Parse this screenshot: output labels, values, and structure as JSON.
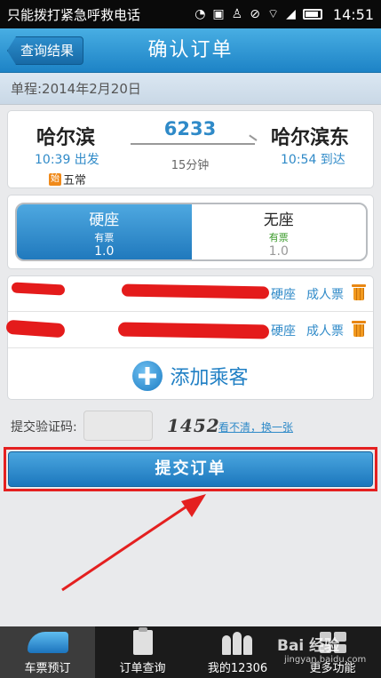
{
  "status_bar": {
    "notice": "只能拨打紧急呼救电话",
    "time": "14:51"
  },
  "header": {
    "back_label": "查询结果",
    "title": "确认订单"
  },
  "trip": {
    "date_text": "单程:2014年2月20日"
  },
  "train": {
    "from_station": "哈尔滨",
    "from_time": "10:39 出发",
    "origin_badge": "始",
    "origin_station": "五常",
    "number": "6233",
    "duration": "15分钟",
    "to_station": "哈尔滨东",
    "to_time": "10:54 到达"
  },
  "seats": [
    {
      "name": "硬座",
      "availability": "有票",
      "price": "1.0",
      "selected": true
    },
    {
      "name": "无座",
      "availability": "有票",
      "price": "1.0",
      "selected": false
    }
  ],
  "passengers": [
    {
      "seat": "硬座",
      "ticket_type": "成人票"
    },
    {
      "seat": "硬座",
      "ticket_type": "成人票"
    }
  ],
  "add_passenger_label": "添加乘客",
  "captcha": {
    "label": "提交验证码:",
    "value": "",
    "image_text": "1452",
    "refresh_label": "看不清，换一张"
  },
  "submit_label": "提交订单",
  "accent_color": "#2f8ac8",
  "annotation_color": "#e42020",
  "tab_bar": {
    "tabs": [
      {
        "label": "车票预订",
        "icon": "train-icon",
        "active": true
      },
      {
        "label": "订单查询",
        "icon": "order-icon",
        "active": false
      },
      {
        "label": "我的12306",
        "icon": "people-icon",
        "active": false
      },
      {
        "label": "更多功能",
        "icon": "more-icon",
        "active": false
      }
    ]
  },
  "watermark": {
    "brand": "Bai 经验",
    "url": "jingyan.baidu.com"
  }
}
